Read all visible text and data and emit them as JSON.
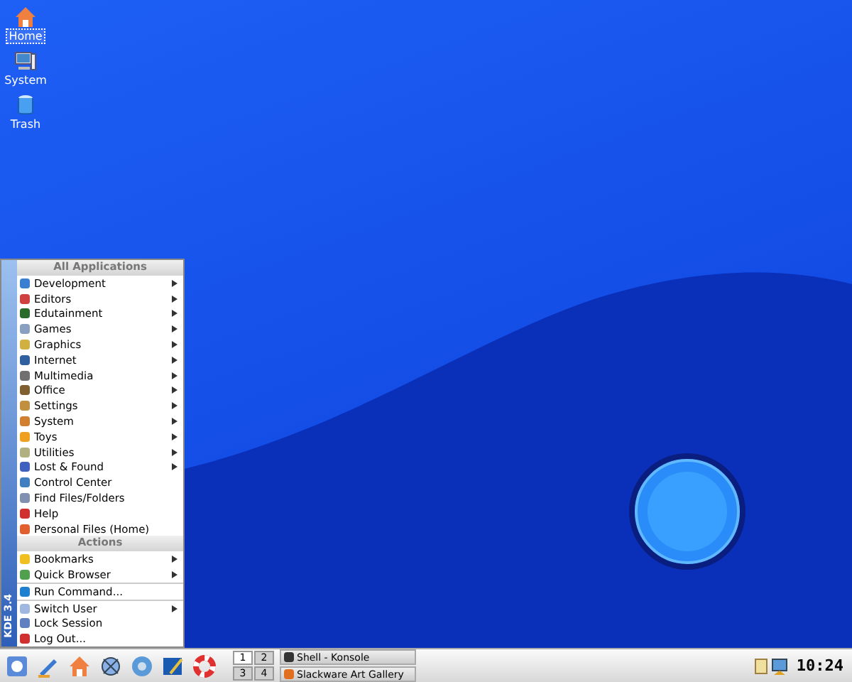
{
  "desktop_icons": [
    {
      "label": "Home",
      "selected": true
    },
    {
      "label": "System",
      "selected": false
    },
    {
      "label": "Trash",
      "selected": false
    }
  ],
  "kmenu": {
    "side_label": "KDE 3.4",
    "entries": [
      {
        "kind": "header",
        "label": "All Applications"
      },
      {
        "kind": "item",
        "label": "Development",
        "submenu": true
      },
      {
        "kind": "item",
        "label": "Editors",
        "submenu": true
      },
      {
        "kind": "item",
        "label": "Edutainment",
        "submenu": true
      },
      {
        "kind": "item",
        "label": "Games",
        "submenu": true
      },
      {
        "kind": "item",
        "label": "Graphics",
        "submenu": true
      },
      {
        "kind": "item",
        "label": "Internet",
        "submenu": true
      },
      {
        "kind": "item",
        "label": "Multimedia",
        "submenu": true
      },
      {
        "kind": "item",
        "label": "Office",
        "submenu": true
      },
      {
        "kind": "item",
        "label": "Settings",
        "submenu": true
      },
      {
        "kind": "item",
        "label": "System",
        "submenu": true
      },
      {
        "kind": "item",
        "label": "Toys",
        "submenu": true
      },
      {
        "kind": "item",
        "label": "Utilities",
        "submenu": true
      },
      {
        "kind": "item",
        "label": "Lost & Found",
        "submenu": true
      },
      {
        "kind": "item",
        "label": "Control Center",
        "submenu": false
      },
      {
        "kind": "item",
        "label": "Find Files/Folders",
        "submenu": false
      },
      {
        "kind": "item",
        "label": "Help",
        "submenu": false
      },
      {
        "kind": "item",
        "label": "Personal Files (Home)",
        "submenu": false
      },
      {
        "kind": "header",
        "label": "Actions"
      },
      {
        "kind": "item",
        "label": "Bookmarks",
        "submenu": true
      },
      {
        "kind": "item",
        "label": "Quick Browser",
        "submenu": true
      },
      {
        "kind": "separator"
      },
      {
        "kind": "item",
        "label": "Run Command...",
        "submenu": false
      },
      {
        "kind": "separator"
      },
      {
        "kind": "item",
        "label": "Switch User",
        "submenu": true
      },
      {
        "kind": "item",
        "label": "Lock Session",
        "submenu": false
      },
      {
        "kind": "item",
        "label": "Log Out...",
        "submenu": false
      }
    ]
  },
  "taskbar": {
    "pager": [
      {
        "label": "1",
        "selected": true
      },
      {
        "label": "2",
        "selected": false
      },
      {
        "label": "3",
        "selected": false
      },
      {
        "label": "4",
        "selected": false
      }
    ],
    "tasks": [
      {
        "label": "Shell - Konsole"
      },
      {
        "label": "Slackware Art Gallery"
      }
    ],
    "clock": "10:24"
  }
}
